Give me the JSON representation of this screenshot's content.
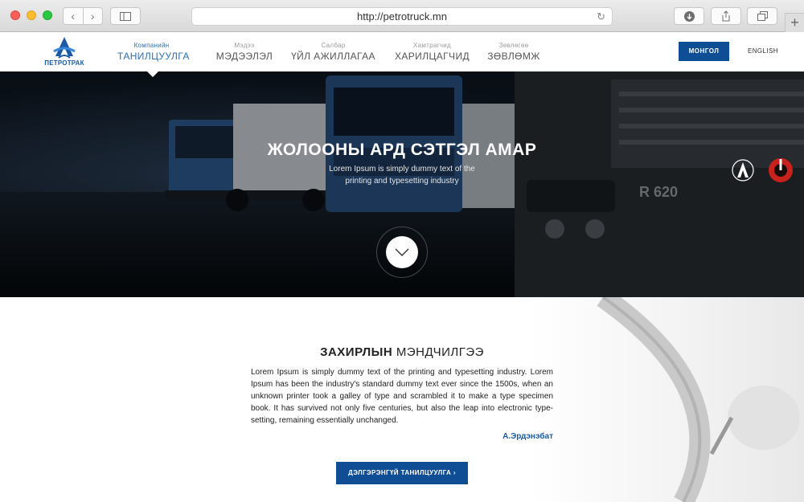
{
  "browser": {
    "url": "http://petrotruck.mn",
    "new_tab_label": "+"
  },
  "site": {
    "logo_text": "ПЕТРОТРАК",
    "menu": [
      {
        "small": "Компанийн",
        "big": "ТАНИЛЦУУЛГА",
        "active": true
      },
      {
        "small": "Мэдээ",
        "big": "МЭДЭЭЛЭЛ"
      },
      {
        "small": "Салбар",
        "big": "ҮЙЛ АЖИЛЛАГАА"
      },
      {
        "small": "Хамтрагчид",
        "big": "ХАРИЛЦАГЧИД"
      },
      {
        "small": "Зөвлөгөө",
        "big": "ЗӨВЛӨМЖ"
      }
    ],
    "lang_active": "МОНГОЛ",
    "lang_other": "ENGLISH",
    "accent_color": "#0f4d94"
  },
  "hero": {
    "title": "ЖОЛООНЫ АРД СЭТГЭЛ АМАР",
    "subtitle": "Lorem Ipsum is simply dummy text of the printing and typesetting industry"
  },
  "content": {
    "greeting_bold": "ЗАХИРЛЫН",
    "greeting_light": " МЭНДЧИЛГЭЭ",
    "body": "Lorem Ipsum is simply dummy text of the printing and typesetting industry. Lorem Ipsum has been the industry's standard dummy text ever since the 1500s, when an unknown printer took a galley of type and scrambled it to make a type specimen book. It has survived not only five centuries, but also the leap into electronic type-setting, remaining essentially unchanged.",
    "signature": "А.Эрдэнэбат",
    "cta_label": "ДЭЛГЭРЭНГҮЙ ТАНИЛЦУУЛГА  ›"
  }
}
